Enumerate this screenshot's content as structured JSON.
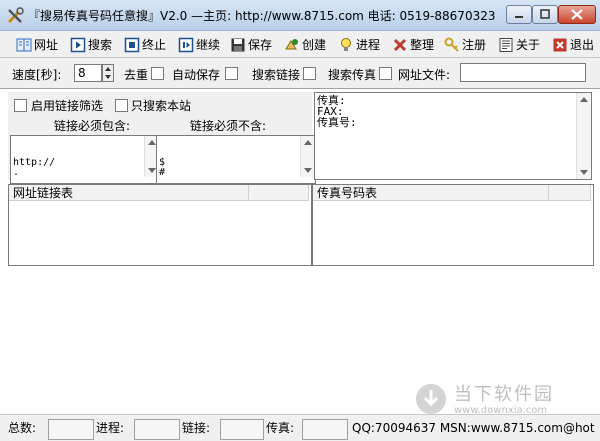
{
  "title": "『搜易传真号码任意搜』V2.0 —主页: http://www.8715.com 电话: 0519-88670323",
  "toolbar": [
    {
      "label": "网址",
      "icon": "book-icon",
      "color": "#2b6cc4"
    },
    {
      "label": "搜索",
      "icon": "play-icon",
      "color": "#1e4f8f"
    },
    {
      "label": "终止",
      "icon": "stop-icon",
      "color": "#1e4f8f"
    },
    {
      "label": "继续",
      "icon": "pause-icon",
      "color": "#1e4f8f"
    },
    {
      "label": "保存",
      "icon": "floppy-icon",
      "color": "#333333"
    },
    {
      "label": "创建",
      "icon": "create-icon",
      "color": "#2d8a2d"
    },
    {
      "label": "进程",
      "icon": "bulb-icon",
      "color": "#caa200"
    },
    {
      "label": "整理",
      "icon": "tidy-icon",
      "color": "#c0392b"
    },
    {
      "label": "注册",
      "icon": "key-icon",
      "color": "#c9a227"
    },
    {
      "label": "关于",
      "icon": "about-icon",
      "color": "#444444"
    },
    {
      "label": "退出",
      "icon": "exit-icon",
      "color": "#c0392b"
    }
  ],
  "options": {
    "speed_label": "速度[秒]:",
    "speed_value": "8",
    "dedupe_label": "去重",
    "autosave_label": "自动保存",
    "search_links_label": "搜索链接",
    "search_fax_label": "搜索传真",
    "url_file_label": "网址文件:"
  },
  "filter": {
    "enable_label": "启用链接筛选",
    "site_only_label": "只搜索本站",
    "must_include_label": "链接必须包含:",
    "must_exclude_label": "链接必须不含:",
    "include_text": "http://\n.",
    "exclude_text": "$\n#"
  },
  "fax_box_text": "传真:\nFAX:\n传真号:",
  "lists": {
    "url_list_header": "网址链接表",
    "fax_list_header": "传真号码表"
  },
  "status": {
    "total_label": "总数:",
    "progress_label": "进程:",
    "links_label": "链接:",
    "fax_label": "传真:",
    "contact": "QQ:70094637 MSN:www.8715.com@hot"
  },
  "watermark": {
    "line1": "当下软件园",
    "line2": "www.downxia.com"
  }
}
